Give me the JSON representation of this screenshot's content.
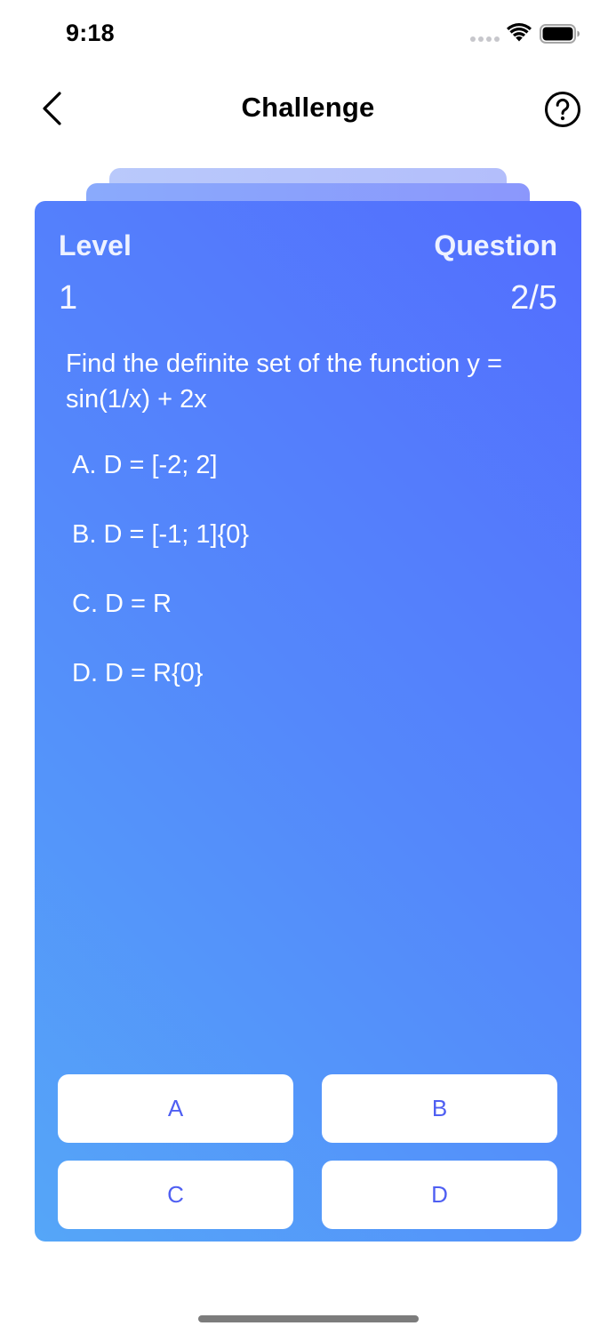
{
  "status_bar": {
    "time": "9:18"
  },
  "nav": {
    "title": "Challenge",
    "back_icon": "chevron-left-icon",
    "help_icon": "question-circle-icon"
  },
  "card": {
    "level_label": "Level",
    "level_value": "1",
    "question_label": "Question",
    "question_progress": "2/5",
    "question_text": "Find the definite set of the function y = sin(1/x) + 2x",
    "options": [
      "A. D = [-2; 2]",
      "B. D = [-1; 1]{0}",
      "C. D = R",
      "D. D = R{0}"
    ],
    "gradient_start": "#55a6f8",
    "gradient_end": "#536dfe"
  },
  "answers": {
    "a": "A",
    "b": "B",
    "c": "C",
    "d": "D",
    "text_color": "#4f5ff2"
  }
}
